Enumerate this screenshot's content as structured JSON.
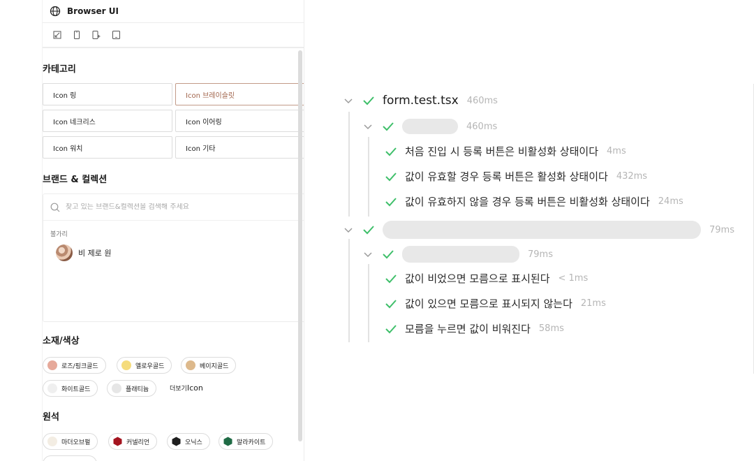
{
  "browser": {
    "title": "Browser UI",
    "tools": [
      {
        "icon": "responsive-icon"
      },
      {
        "icon": "mobile-icon"
      },
      {
        "icon": "mobile-plus-icon"
      },
      {
        "icon": "tablet-icon"
      }
    ]
  },
  "category": {
    "title": "카테고리",
    "buttons": [
      {
        "label": "Icon 링",
        "active": false
      },
      {
        "label": "Icon 브레이슬릿",
        "active": true
      },
      {
        "label": "Icon 네크리스",
        "active": false
      },
      {
        "label": "Icon 이어링",
        "active": false
      },
      {
        "label": "Icon 워치",
        "active": false
      },
      {
        "label": "Icon 기타",
        "active": false
      }
    ]
  },
  "brand": {
    "title": "브랜드 & 컬렉션",
    "search_placeholder": "찾고 있는 브랜드&컬렉션을 검색해 주세요",
    "group_label": "불가리",
    "item_name": "비 제로 원"
  },
  "material": {
    "title": "소재/색상",
    "chips": [
      {
        "label": "로즈/핑크골드",
        "color": "#e6a99a"
      },
      {
        "label": "옐로우골드",
        "color": "#f5dc7c"
      },
      {
        "label": "베이지골드",
        "color": "#ddb98c"
      },
      {
        "label": "화이트골드",
        "color": "#efefef"
      },
      {
        "label": "플래티늄",
        "color": "#e6e6e6"
      }
    ],
    "more_prefix": "더보기",
    "more_suffix": "Icon"
  },
  "gem": {
    "title": "원석",
    "chips": [
      {
        "label": "마더오브펄",
        "color": "#f3ede3",
        "shape": "circle"
      },
      {
        "label": "커넬리언",
        "color": "#a4141f",
        "shape": "hex"
      },
      {
        "label": "오닉스",
        "color": "#1e1e1e",
        "shape": "hex"
      },
      {
        "label": "말라카이트",
        "color": "#1f6b45",
        "shape": "hex"
      }
    ]
  },
  "tests": {
    "accent": "#3fbf6a",
    "file": {
      "name": "form.test.tsx",
      "time": "460ms"
    },
    "suite1": {
      "time": "460ms"
    },
    "suite1_tests": [
      {
        "label": "처음 진입 시 등록 버튼은 비활성화 상태이다",
        "time": "4ms"
      },
      {
        "label": "값이 유효할 경우 등록 버튼은 활성화 상태이다",
        "time": "432ms"
      },
      {
        "label": "값이 유효하지 않을 경우 등록 버튼은 비활성화 상태이다",
        "time": "24ms"
      }
    ],
    "suite2": {
      "time": "79ms"
    },
    "suite3": {
      "time": "79ms"
    },
    "suite3_tests": [
      {
        "label": "값이 비었으면 모름으로 표시된다",
        "time": "< 1ms"
      },
      {
        "label": "값이 있으면 모름으로 표시되지 않는다",
        "time": "21ms"
      },
      {
        "label": "모름을 누르면 값이 비워진다",
        "time": "58ms"
      }
    ]
  }
}
